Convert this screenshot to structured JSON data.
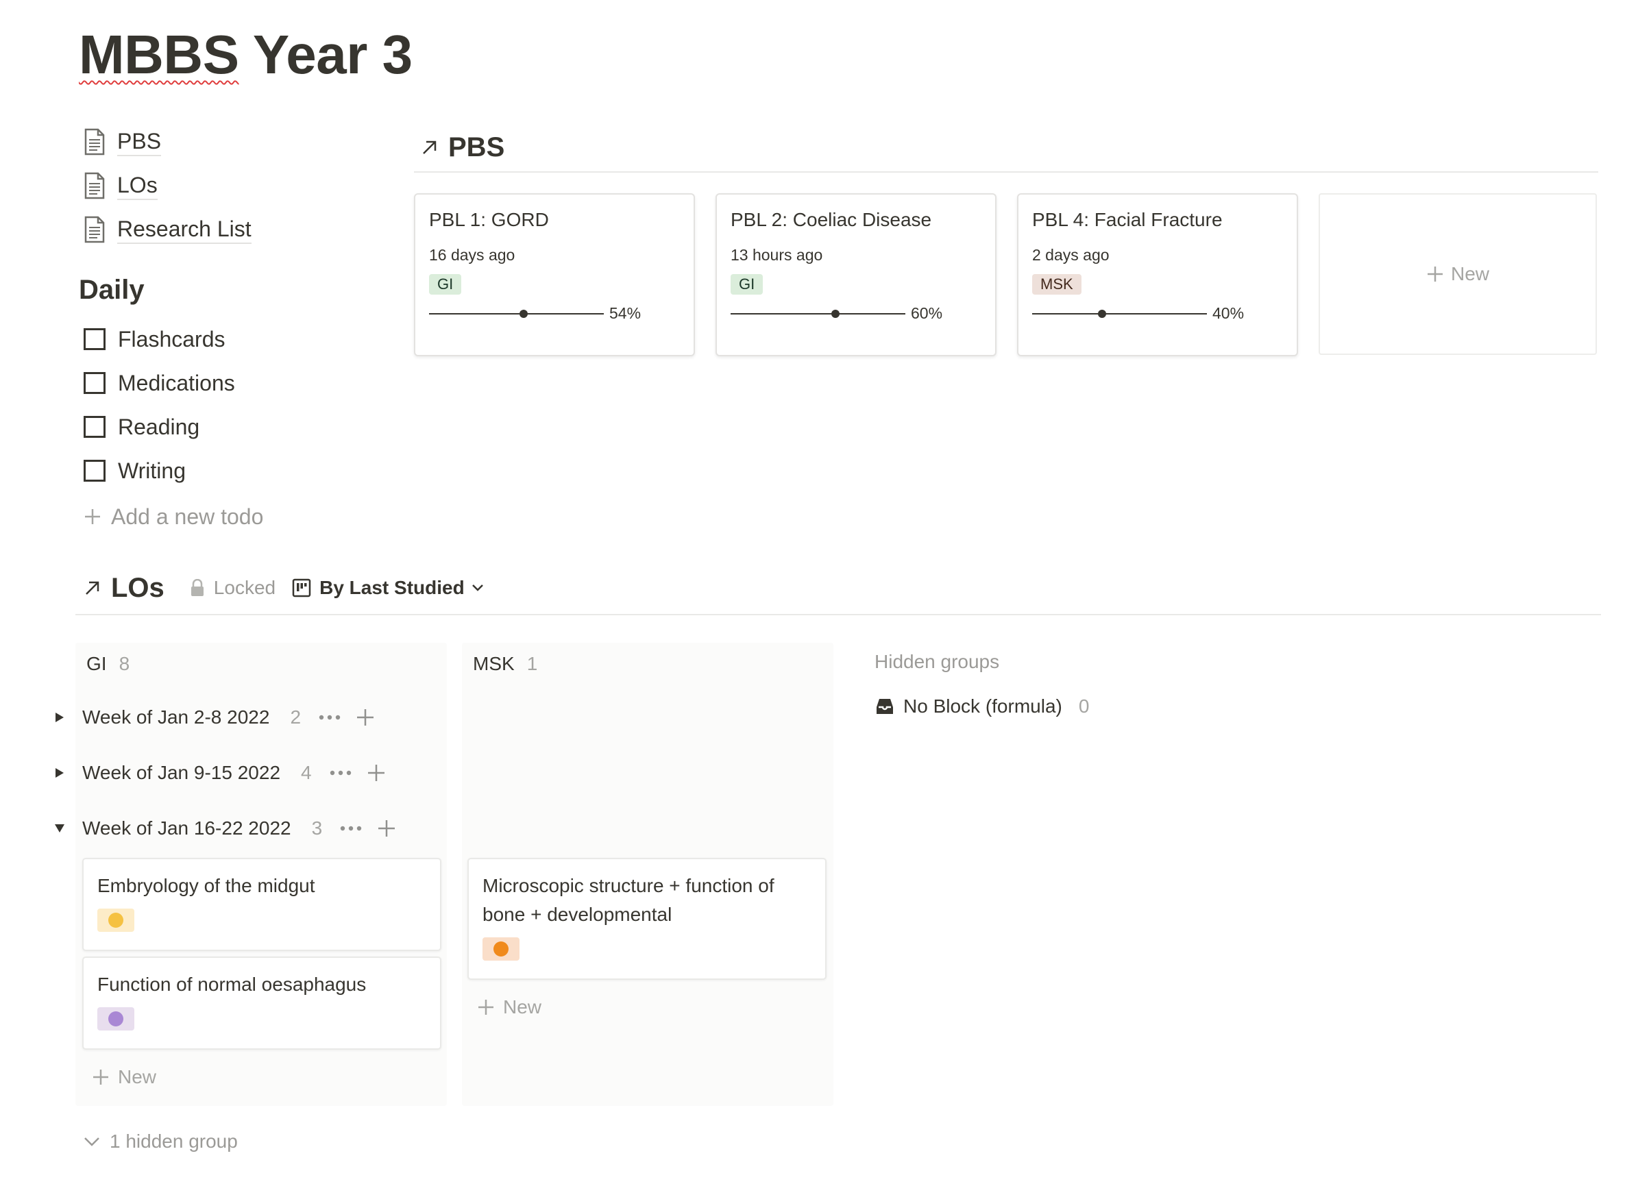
{
  "page": {
    "title_spelled": "MBBS",
    "title_rest": " Year 3"
  },
  "links": [
    {
      "label": "PBS"
    },
    {
      "label": "LOs"
    },
    {
      "label": "Research List"
    }
  ],
  "daily": {
    "heading": "Daily",
    "todos": [
      {
        "label": "Flashcards",
        "checked": false
      },
      {
        "label": "Medications",
        "checked": false
      },
      {
        "label": "Reading",
        "checked": false
      },
      {
        "label": "Writing",
        "checked": false
      }
    ],
    "add_label": "Add a new todo"
  },
  "pbs": {
    "title": "PBS",
    "new_label": "New",
    "cards": [
      {
        "title": "PBL 1: GORD",
        "time": "16 days ago",
        "tag": "GI",
        "progress": 0.54,
        "progress_label": "54%"
      },
      {
        "title": "PBL 2: Coeliac Disease",
        "time": "13 hours ago",
        "tag": "GI",
        "progress": 0.6,
        "progress_label": "60%"
      },
      {
        "title": "PBL 4: Facial Fracture",
        "time": "2 days ago",
        "tag": "MSK",
        "progress": 0.4,
        "progress_label": "40%"
      }
    ]
  },
  "los": {
    "title": "LOs",
    "locked_label": "Locked",
    "view_label": "By Last Studied",
    "columns": [
      {
        "name": "GI",
        "count": "8"
      },
      {
        "name": "MSK",
        "count": "1"
      }
    ],
    "hidden_groups_label": "Hidden groups",
    "hidden_group": {
      "name": "No Block (formula)",
      "count": "0"
    },
    "weeks": [
      {
        "label": "Week of Jan 2-8 2022",
        "count": "2",
        "expanded": false
      },
      {
        "label": "Week of Jan 9-15 2022",
        "count": "4",
        "expanded": false
      },
      {
        "label": "Week of Jan 16-22 2022",
        "count": "3",
        "expanded": true
      }
    ],
    "cards": [
      {
        "title": "Embryology of the midgut",
        "chip_bg": "#fdecc8",
        "chip_dot": "#f5c142"
      },
      {
        "title": "Function of normal oesaphagus",
        "chip_bg": "#e8deee",
        "chip_dot": "#a987d4"
      },
      {
        "title": "Microscopic structure + function of bone + developmental",
        "chip_bg": "#fadec9",
        "chip_dot": "#f08a1c"
      }
    ],
    "new_label": "New",
    "hidden_group_toggle": "1 hidden group"
  },
  "colors": {
    "gi_tag": "#dbeddb",
    "msk_tag": "#eee0da",
    "text": "#37352f",
    "muted": "#9b9a97"
  }
}
